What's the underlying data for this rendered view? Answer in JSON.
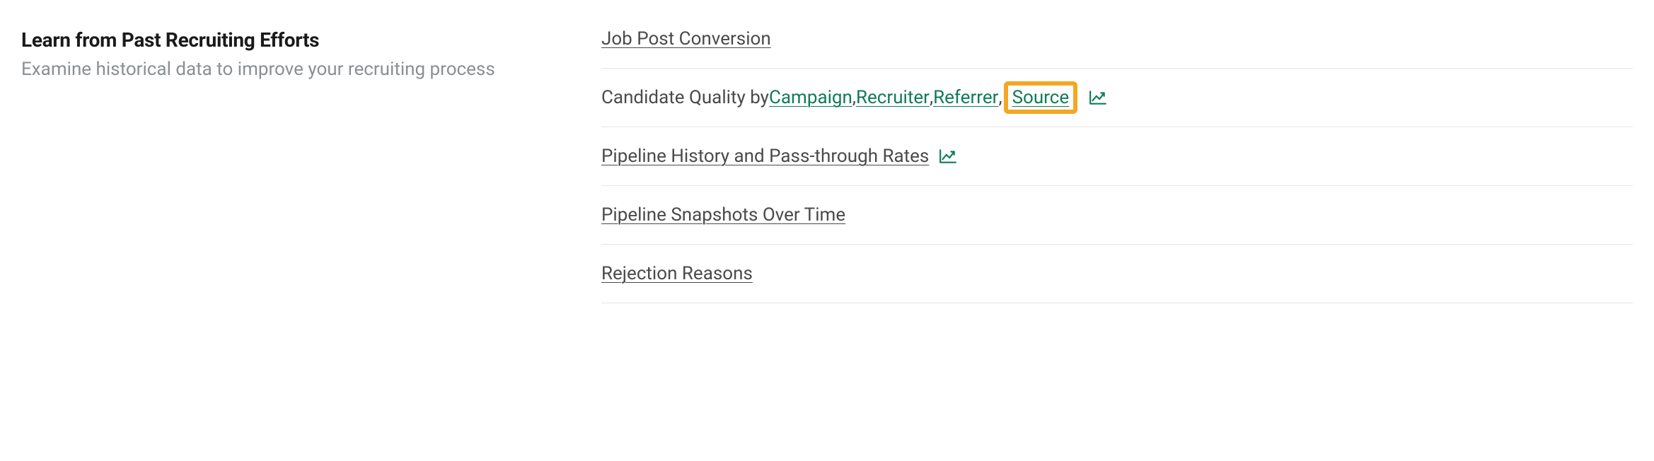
{
  "left": {
    "title": "Learn from Past Recruiting Efforts",
    "subtitle": "Examine historical data to improve your recruiting process"
  },
  "rows": {
    "job_post_conversion": "Job Post Conversion",
    "candidate_quality_prefix": "Candidate Quality by ",
    "campaign": "Campaign",
    "recruiter": "Recruiter",
    "referrer": "Referrer",
    "source": "Source",
    "comma": ", ",
    "pipeline_history": "Pipeline History and Pass-through Rates",
    "pipeline_snapshots": "Pipeline Snapshots Over Time",
    "rejection_reasons": "Rejection Reasons"
  },
  "colors": {
    "link_green": "#0f7b57",
    "highlight_orange": "#f5a623"
  }
}
